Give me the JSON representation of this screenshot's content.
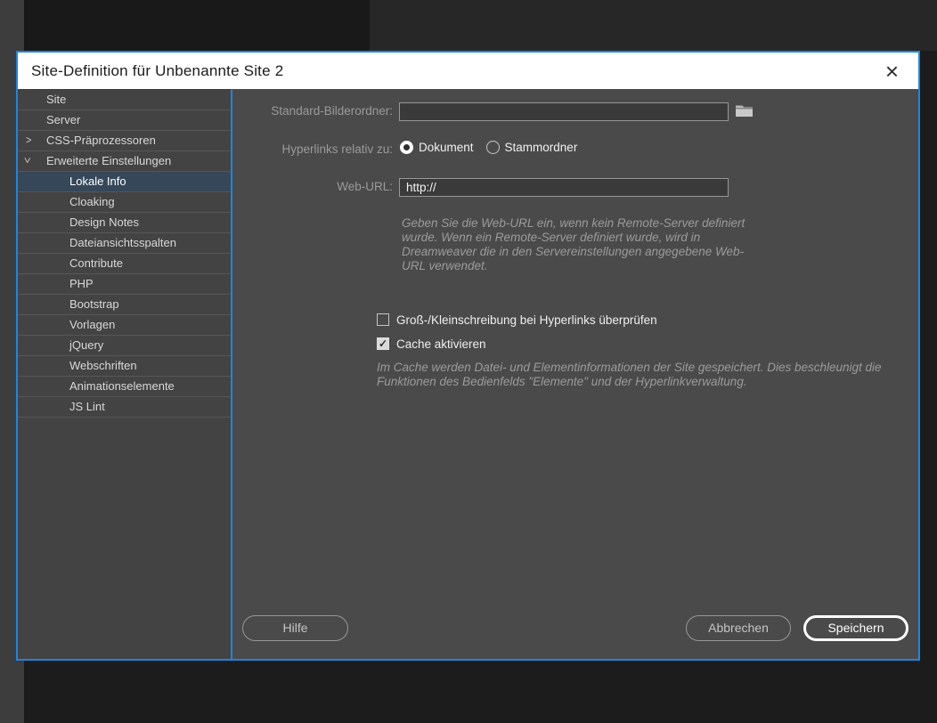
{
  "window": {
    "title": "Site-Definition für Unbenannte Site 2"
  },
  "icons": {
    "close": "×",
    "chevron": ">",
    "check": "✓",
    "folder": "folder-icon"
  },
  "colors": {
    "accent_blue": "#1d86e0",
    "selected_item_bg": "#36475a",
    "titlebar_bg": "#ffffff",
    "dialog_bg": "#4a4a4a",
    "sidebar_bg": "#434343"
  },
  "sidebar": {
    "items": [
      {
        "label": "Site",
        "level": 0,
        "selected": false
      },
      {
        "label": "Server",
        "level": 0,
        "selected": false
      },
      {
        "label": "CSS-Präprozessoren",
        "level": 0,
        "selected": false,
        "chevron": "collapsed"
      },
      {
        "label": "Erweiterte Einstellungen",
        "level": 0,
        "selected": false,
        "chevron": "expanded"
      },
      {
        "label": "Lokale Info",
        "level": 1,
        "selected": true
      },
      {
        "label": "Cloaking",
        "level": 1,
        "selected": false
      },
      {
        "label": "Design Notes",
        "level": 1,
        "selected": false
      },
      {
        "label": "Dateiansichtsspalten",
        "level": 1,
        "selected": false
      },
      {
        "label": "Contribute",
        "level": 1,
        "selected": false
      },
      {
        "label": "PHP",
        "level": 1,
        "selected": false
      },
      {
        "label": "Bootstrap",
        "level": 1,
        "selected": false
      },
      {
        "label": "Vorlagen",
        "level": 1,
        "selected": false
      },
      {
        "label": "jQuery",
        "level": 1,
        "selected": false
      },
      {
        "label": "Webschriften",
        "level": 1,
        "selected": false
      },
      {
        "label": "Animationselemente",
        "level": 1,
        "selected": false
      },
      {
        "label": "JS Lint",
        "level": 1,
        "selected": false
      }
    ]
  },
  "form": {
    "default_images_label": "Standard-Bilderordner:",
    "default_images_value": "",
    "links_relative_label": "Hyperlinks relativ zu:",
    "radio_options": [
      {
        "label": "Dokument",
        "selected": true
      },
      {
        "label": "Stammordner",
        "selected": false
      }
    ],
    "web_url_label": "Web-URL:",
    "web_url_value": "http://",
    "web_url_help": "Geben Sie die Web-URL ein, wenn kein Remote-Server definiert wurde. Wenn ein Remote-Server definiert wurde, wird in Dreamweaver die in den Servereinstellungen angegebene Web-URL verwendet.",
    "checkboxes": [
      {
        "label": "Groß-/Kleinschreibung bei Hyperlinks überprüfen",
        "checked": false
      },
      {
        "label": "Cache aktivieren",
        "checked": true
      }
    ],
    "cache_help": "Im Cache werden Datei- und Elementinformationen der Site gespeichert. Dies beschleunigt die Funktionen des Bedienfelds \"Elemente\" und der Hyperlinkverwaltung."
  },
  "buttons": {
    "help": "Hilfe",
    "cancel": "Abbrechen",
    "save": "Speichern"
  }
}
